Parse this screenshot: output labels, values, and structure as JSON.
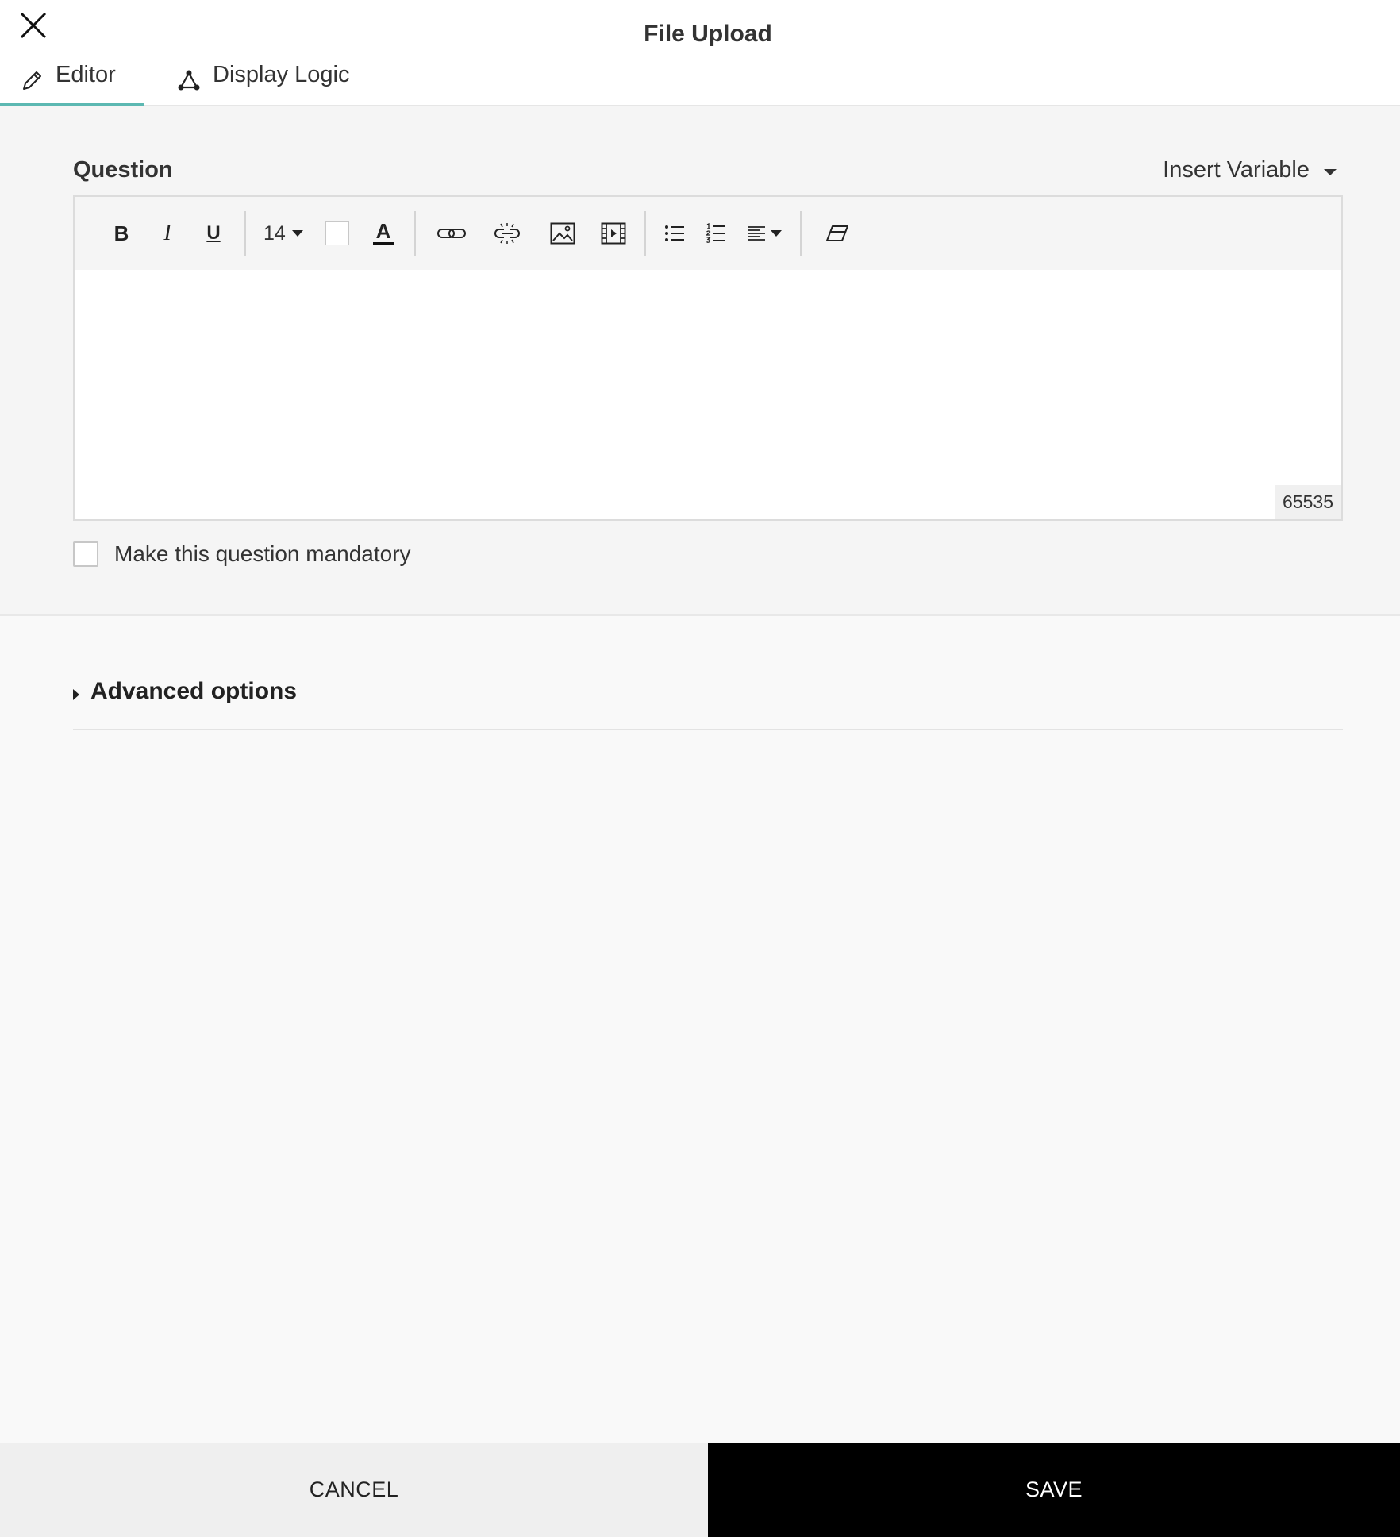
{
  "header": {
    "title": "File Upload",
    "close_icon": "close-icon",
    "tabs": [
      {
        "label": "Editor",
        "icon": "pencil-icon",
        "active": true
      },
      {
        "label": "Display Logic",
        "icon": "logic-nodes-icon",
        "active": false
      }
    ],
    "accent_color": "#5cb8b2"
  },
  "question": {
    "label": "Question",
    "insert_variable": "Insert Variable",
    "toolbar": {
      "bold": "B",
      "italic": "I",
      "underline": "U",
      "font_size": "14",
      "text_color_glyph": "A"
    },
    "char_counter": "65535",
    "mandatory_label": "Make this question mandatory",
    "mandatory_checked": false
  },
  "advanced": {
    "label": "Advanced options"
  },
  "footer": {
    "cancel_label": "CANCEL",
    "save_label": "SAVE"
  }
}
